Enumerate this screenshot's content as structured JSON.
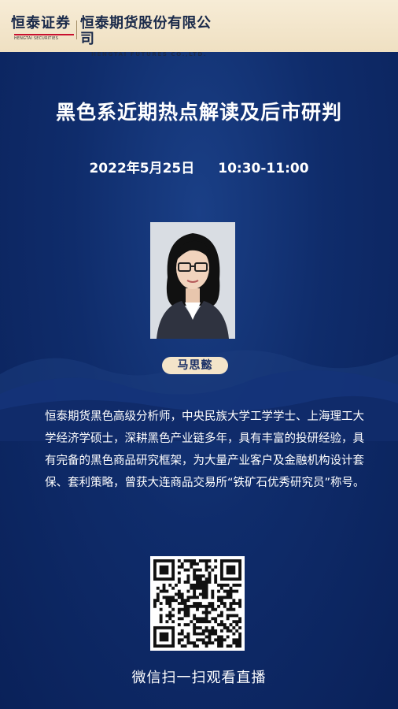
{
  "header": {
    "logo_left_cn": "恒泰证券",
    "logo_left_en": "HENGTAI SECURITIES",
    "logo_right_cn": "恒泰期货股份有限公司",
    "logo_right_en": "HENGTAI FUTURES CO.,LTD."
  },
  "event": {
    "title": "黑色系近期热点解读及后市研判",
    "date": "2022年5月25日",
    "time": "10:30-11:00"
  },
  "speaker": {
    "name": "马思懿",
    "bio": "恒泰期货黑色高级分析师，中央民族大学工学学士、上海理工大学经济学硕士，深耕黑色产业链多年，具有丰富的投研经验，具有完备的黑色商品研究框架，为大量产业客户及金融机构设计套保、套利策略，曾获大连商品交易所“铁矿石优秀研究员”称号。"
  },
  "qr": {
    "caption": "微信扫一扫观看直播"
  },
  "colors": {
    "background": "#0f2c6b",
    "header_bg": "#f3e4c9",
    "accent_red": "#c8102e"
  }
}
